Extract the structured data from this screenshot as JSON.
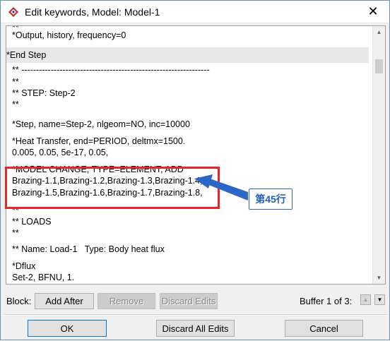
{
  "window": {
    "title": "Edit keywords, Model: Model-1",
    "icon": "abaqus-app-icon",
    "close_glyph": "✕"
  },
  "editor": {
    "lines": [
      {
        "text": "*Output, history, frequency=0"
      },
      {
        "text": "*End Step"
      },
      {
        "text": "** ----------------------------------------------------------------"
      },
      {
        "text": "**"
      },
      {
        "text": "** STEP: Step-2"
      },
      {
        "text": "**"
      },
      {
        "text": "*Step, name=Step-2, nlgeom=NO, inc=10000"
      },
      {
        "text": "*Heat Transfer, end=PERIOD, deltmx=1500."
      },
      {
        "text": "0.005, 0.05, 5e-17, 0.05,"
      },
      {
        "text": "*MODEL CHANGE, TYPE=ELEMENT, ADD"
      },
      {
        "text": "Brazing-1.1,Brazing-1.2,Brazing-1.3,Brazing-1.4,"
      },
      {
        "text": "Brazing-1.5,Brazing-1.6,Brazing-1.7,Brazing-1.8,"
      },
      {
        "text": "**"
      },
      {
        "text": "** LOADS"
      },
      {
        "text": "**"
      },
      {
        "text": "** Name: Load-1   Type: Body heat flux"
      },
      {
        "text": "*Dflux"
      },
      {
        "text": "Set-2, BFNU, 1."
      }
    ],
    "top_partial_line": "**"
  },
  "annotation": {
    "label": "第45行",
    "box_color": "#e8262a",
    "arrow_color": "#2b67c9"
  },
  "block_bar": {
    "label": "Block:",
    "add_after": "Add After",
    "remove": "Remove",
    "discard_edits": "Discard Edits",
    "buffer": "Buffer 1 of 3:"
  },
  "footer": {
    "ok": "OK",
    "discard_all": "Discard All Edits",
    "cancel": "Cancel"
  }
}
